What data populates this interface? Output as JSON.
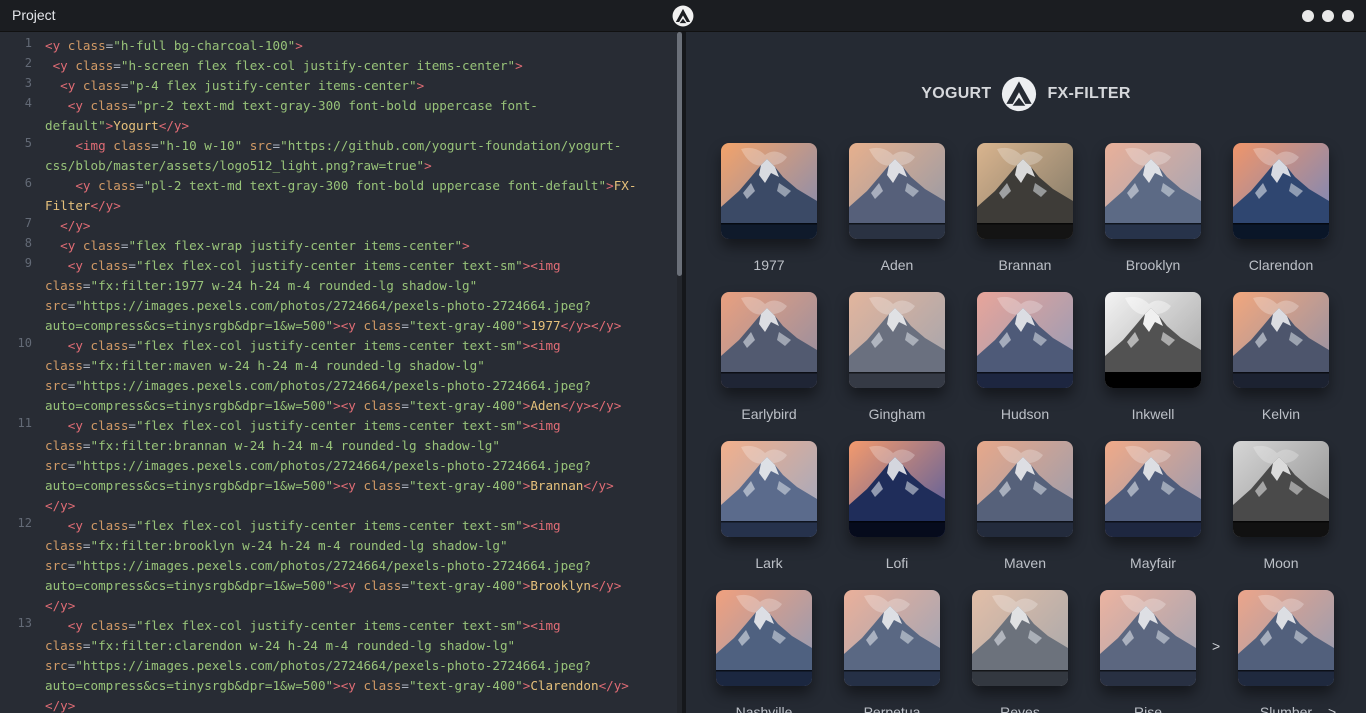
{
  "window": {
    "project_label": "Project",
    "logo_icon": "yogurt-logo-icon",
    "controls": [
      "minimize-dot",
      "maximize-dot",
      "close-dot"
    ]
  },
  "editor": {
    "line_numbers": [
      "1",
      "2",
      "3",
      "4",
      "5",
      "6",
      "7",
      "8",
      "9",
      "10",
      "11",
      "12",
      "13"
    ],
    "lines": [
      [
        [
          "t",
          "<y "
        ],
        [
          "a",
          "class"
        ],
        [
          "p",
          "="
        ],
        [
          "s",
          "\"h-full bg-charcoal-100\""
        ],
        [
          "t",
          ">"
        ]
      ],
      [
        [
          "t",
          " <y "
        ],
        [
          "a",
          "class"
        ],
        [
          "p",
          "="
        ],
        [
          "s",
          "\"h-screen flex flex-col justify-center items-center\""
        ],
        [
          "t",
          ">"
        ]
      ],
      [
        [
          "t",
          "  <y "
        ],
        [
          "a",
          "class"
        ],
        [
          "p",
          "="
        ],
        [
          "s",
          "\"p-4 flex justify-center items-center\""
        ],
        [
          "t",
          ">"
        ]
      ],
      [
        [
          "t",
          "   <y "
        ],
        [
          "a",
          "class"
        ],
        [
          "p",
          "="
        ],
        [
          "s",
          "\"pr-2 text-md text-gray-300 font-bold uppercase font-"
        ]
      ],
      [
        [
          "s",
          "default\""
        ],
        [
          "t",
          ">"
        ],
        [
          "tx",
          "Yogurt"
        ],
        [
          "t",
          "</y>"
        ]
      ],
      [
        [
          "t",
          "    <img "
        ],
        [
          "a",
          "class"
        ],
        [
          "p",
          "="
        ],
        [
          "s",
          "\"h-10 w-10\""
        ],
        [
          "p",
          " "
        ],
        [
          "a",
          "src"
        ],
        [
          "p",
          "="
        ],
        [
          "s",
          "\"https://github.com/yogurt-foundation/yogurt-"
        ]
      ],
      [
        [
          "s",
          "css/blob/master/assets/logo512_light.png?raw=true\""
        ],
        [
          "t",
          ">"
        ]
      ],
      [
        [
          "t",
          "    <y "
        ],
        [
          "a",
          "class"
        ],
        [
          "p",
          "="
        ],
        [
          "s",
          "\"pl-2 text-md text-gray-300 font-bold uppercase font-default\""
        ],
        [
          "t",
          ">"
        ],
        [
          "tx",
          "FX-"
        ]
      ],
      [
        [
          "tx",
          "Filter"
        ],
        [
          "t",
          "</y>"
        ]
      ],
      [
        [
          "t",
          "  </y>"
        ]
      ],
      [
        [
          "t",
          "  <y "
        ],
        [
          "a",
          "class"
        ],
        [
          "p",
          "="
        ],
        [
          "s",
          "\"flex flex-wrap justify-center items-center\""
        ],
        [
          "t",
          ">"
        ]
      ],
      [
        [
          "t",
          "   <y "
        ],
        [
          "a",
          "class"
        ],
        [
          "p",
          "="
        ],
        [
          "s",
          "\"flex flex-col justify-center items-center text-sm\""
        ],
        [
          "t",
          ">"
        ],
        [
          "t",
          "<img"
        ]
      ],
      [
        [
          "a",
          "class"
        ],
        [
          "p",
          "="
        ],
        [
          "s",
          "\"fx:filter:1977 w-24 h-24 m-4 rounded-lg shadow-lg\""
        ]
      ],
      [
        [
          "a",
          "src"
        ],
        [
          "p",
          "="
        ],
        [
          "s",
          "\"https://images.pexels.com/photos/2724664/pexels-photo-2724664.jpeg?"
        ]
      ],
      [
        [
          "s",
          "auto=compress&cs=tinysrgb&dpr=1&w=500\""
        ],
        [
          "t",
          ">"
        ],
        [
          "t",
          "<y "
        ],
        [
          "a",
          "class"
        ],
        [
          "p",
          "="
        ],
        [
          "s",
          "\"text-gray-400\""
        ],
        [
          "t",
          ">"
        ],
        [
          "tx",
          "1977"
        ],
        [
          "t",
          "</y></y>"
        ]
      ],
      [
        [
          "t",
          "   <y "
        ],
        [
          "a",
          "class"
        ],
        [
          "p",
          "="
        ],
        [
          "s",
          "\"flex flex-col justify-center items-center text-sm\""
        ],
        [
          "t",
          ">"
        ],
        [
          "t",
          "<img"
        ]
      ],
      [
        [
          "a",
          "class"
        ],
        [
          "p",
          "="
        ],
        [
          "s",
          "\"fx:filter:maven w-24 h-24 m-4 rounded-lg shadow-lg\""
        ]
      ],
      [
        [
          "a",
          "src"
        ],
        [
          "p",
          "="
        ],
        [
          "s",
          "\"https://images.pexels.com/photos/2724664/pexels-photo-2724664.jpeg?"
        ]
      ],
      [
        [
          "s",
          "auto=compress&cs=tinysrgb&dpr=1&w=500\""
        ],
        [
          "t",
          ">"
        ],
        [
          "t",
          "<y "
        ],
        [
          "a",
          "class"
        ],
        [
          "p",
          "="
        ],
        [
          "s",
          "\"text-gray-400\""
        ],
        [
          "t",
          ">"
        ],
        [
          "tx",
          "Aden"
        ],
        [
          "t",
          "</y></y>"
        ]
      ],
      [
        [
          "t",
          "   <y "
        ],
        [
          "a",
          "class"
        ],
        [
          "p",
          "="
        ],
        [
          "s",
          "\"flex flex-col justify-center items-center text-sm\""
        ],
        [
          "t",
          ">"
        ],
        [
          "t",
          "<img"
        ]
      ],
      [
        [
          "a",
          "class"
        ],
        [
          "p",
          "="
        ],
        [
          "s",
          "\"fx:filter:brannan w-24 h-24 m-4 rounded-lg shadow-lg\""
        ]
      ],
      [
        [
          "a",
          "src"
        ],
        [
          "p",
          "="
        ],
        [
          "s",
          "\"https://images.pexels.com/photos/2724664/pexels-photo-2724664.jpeg?"
        ]
      ],
      [
        [
          "s",
          "auto=compress&cs=tinysrgb&dpr=1&w=500\""
        ],
        [
          "t",
          ">"
        ],
        [
          "t",
          "<y "
        ],
        [
          "a",
          "class"
        ],
        [
          "p",
          "="
        ],
        [
          "s",
          "\"text-gray-400\""
        ],
        [
          "t",
          ">"
        ],
        [
          "tx",
          "Brannan"
        ],
        [
          "t",
          "</y>"
        ]
      ],
      [
        [
          "t",
          "</y>"
        ]
      ],
      [
        [
          "t",
          "   <y "
        ],
        [
          "a",
          "class"
        ],
        [
          "p",
          "="
        ],
        [
          "s",
          "\"flex flex-col justify-center items-center text-sm\""
        ],
        [
          "t",
          ">"
        ],
        [
          "t",
          "<img"
        ]
      ],
      [
        [
          "a",
          "class"
        ],
        [
          "p",
          "="
        ],
        [
          "s",
          "\"fx:filter:brooklyn w-24 h-24 m-4 rounded-lg shadow-lg\""
        ]
      ],
      [
        [
          "a",
          "src"
        ],
        [
          "p",
          "="
        ],
        [
          "s",
          "\"https://images.pexels.com/photos/2724664/pexels-photo-2724664.jpeg?"
        ]
      ],
      [
        [
          "s",
          "auto=compress&cs=tinysrgb&dpr=1&w=500\""
        ],
        [
          "t",
          ">"
        ],
        [
          "t",
          "<y "
        ],
        [
          "a",
          "class"
        ],
        [
          "p",
          "="
        ],
        [
          "s",
          "\"text-gray-400\""
        ],
        [
          "t",
          ">"
        ],
        [
          "tx",
          "Brooklyn"
        ],
        [
          "t",
          "</y>"
        ]
      ],
      [
        [
          "t",
          "</y>"
        ]
      ],
      [
        [
          "t",
          "   <y "
        ],
        [
          "a",
          "class"
        ],
        [
          "p",
          "="
        ],
        [
          "s",
          "\"flex flex-col justify-center items-center text-sm\""
        ],
        [
          "t",
          ">"
        ],
        [
          "t",
          "<img"
        ]
      ],
      [
        [
          "a",
          "class"
        ],
        [
          "p",
          "="
        ],
        [
          "s",
          "\"fx:filter:clarendon w-24 h-24 m-4 rounded-lg shadow-lg\""
        ]
      ],
      [
        [
          "a",
          "src"
        ],
        [
          "p",
          "="
        ],
        [
          "s",
          "\"https://images.pexels.com/photos/2724664/pexels-photo-2724664.jpeg?"
        ]
      ],
      [
        [
          "s",
          "auto=compress&cs=tinysrgb&dpr=1&w=500\""
        ],
        [
          "t",
          ">"
        ],
        [
          "t",
          "<y "
        ],
        [
          "a",
          "class"
        ],
        [
          "p",
          "="
        ],
        [
          "s",
          "\"text-gray-400\""
        ],
        [
          "t",
          ">"
        ],
        [
          "tx",
          "Clarendon"
        ],
        [
          "t",
          "</y>"
        ]
      ],
      [
        [
          "t",
          "</y>"
        ]
      ]
    ],
    "colors": {
      "tag": "#e06c75",
      "attr": "#d19a66",
      "string": "#98c379",
      "text": "#e5c07b",
      "punct": "#abb2bf"
    }
  },
  "preview": {
    "brand_left": "YOGURT",
    "brand_right": "FX-FILTER",
    "filters": [
      {
        "name": "1977"
      },
      {
        "name": "Aden"
      },
      {
        "name": "Brannan"
      },
      {
        "name": "Brooklyn"
      },
      {
        "name": "Clarendon"
      },
      {
        "name": "Earlybird"
      },
      {
        "name": "Gingham"
      },
      {
        "name": "Hudson"
      },
      {
        "name": "Inkwell"
      },
      {
        "name": "Kelvin"
      },
      {
        "name": "Lark"
      },
      {
        "name": "Lofi"
      },
      {
        "name": "Maven"
      },
      {
        "name": "Mayfair"
      },
      {
        "name": "Moon"
      },
      {
        "name": "Nashville"
      },
      {
        "name": "Perpetua"
      },
      {
        "name": "Reyes"
      },
      {
        "name": "Rise"
      },
      {
        "name": "Slumber"
      }
    ],
    "stray_chevrons": [
      ">",
      ">"
    ]
  }
}
